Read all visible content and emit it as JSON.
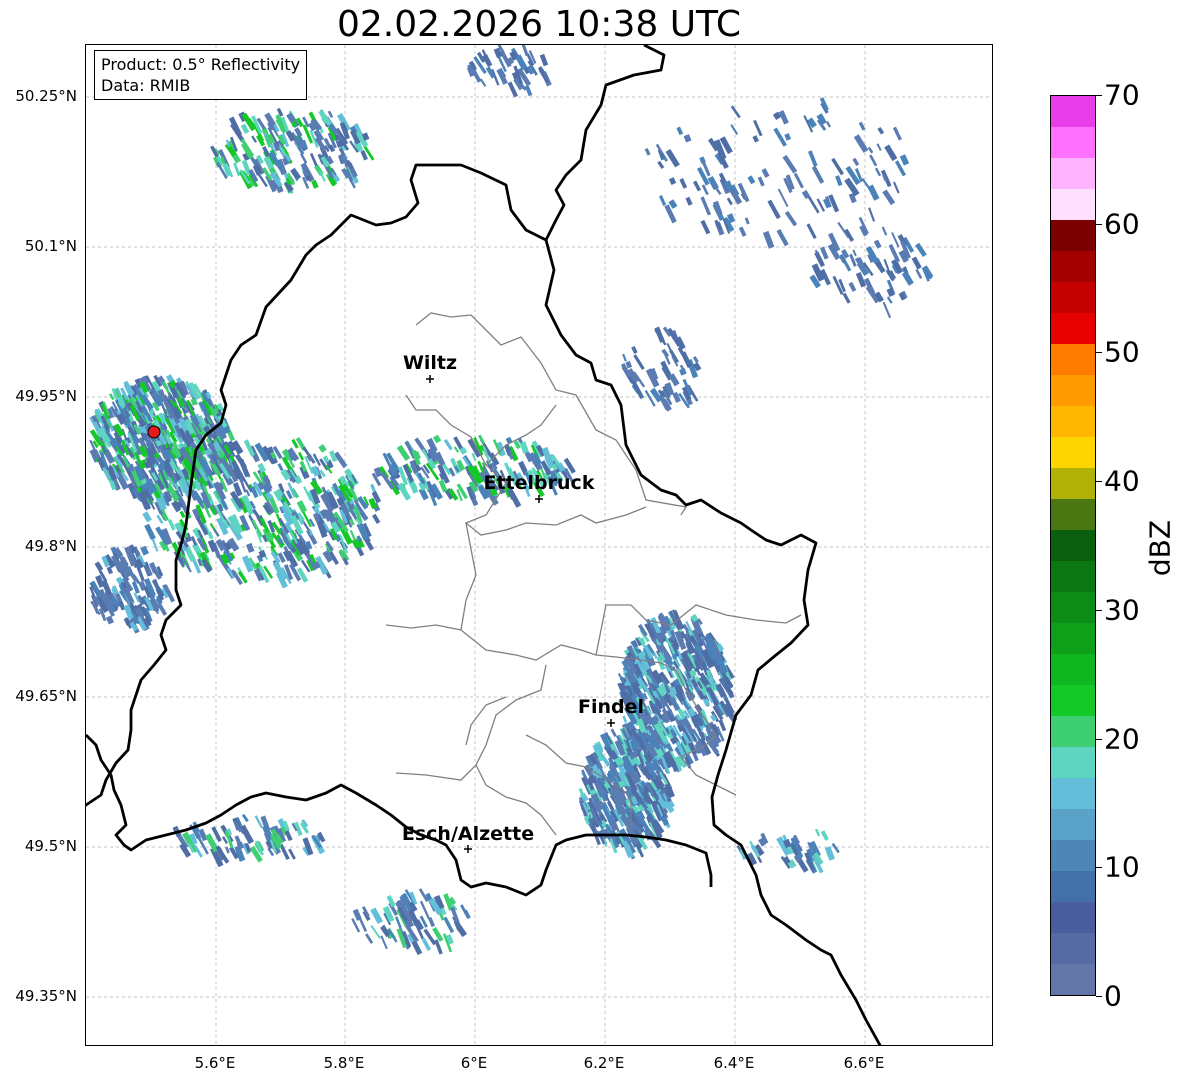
{
  "title": "02.02.2026 10:38 UTC",
  "info": {
    "product": "Product: 0.5° Reflectivity",
    "data": "Data: RMIB"
  },
  "lat_labels": [
    "50.25°N",
    "50.1°N",
    "49.95°N",
    "49.8°N",
    "49.65°N",
    "49.5°N",
    "49.35°N"
  ],
  "lon_labels": [
    "5.6°E",
    "5.8°E",
    "6°E",
    "6.2°E",
    "6.4°E",
    "6.6°E"
  ],
  "cities": [
    {
      "name": "Wiltz"
    },
    {
      "name": "Ettelbruck"
    },
    {
      "name": "Findel"
    },
    {
      "name": "Esch/Alzette"
    }
  ],
  "colorbar": {
    "unit": "dBZ",
    "min": 0,
    "max": 70,
    "ticks": [
      "0",
      "10",
      "20",
      "30",
      "40",
      "50",
      "60",
      "70"
    ],
    "colors": [
      "#6475a7",
      "#566aa4",
      "#4a5e9f",
      "#4470aa",
      "#4f86b8",
      "#5aa2c8",
      "#63bfd9",
      "#5dd5c0",
      "#3ecf72",
      "#14c927",
      "#10b61f",
      "#0fa01a",
      "#0c8b17",
      "#0a7713",
      "#0a5f0f",
      "#4a7712",
      "#b1b208",
      "#ffd501",
      "#ffb702",
      "#ff9a00",
      "#ff7c00",
      "#e60000",
      "#c50000",
      "#a30000",
      "#7d0000",
      "#ffdfff",
      "#ffb3ff",
      "#ff71ff",
      "#e83de8"
    ]
  },
  "colors": {
    "border": "#000000",
    "canton": "#808080",
    "grid": "#b0b0b0",
    "radar_site": "#e41a1c"
  }
}
